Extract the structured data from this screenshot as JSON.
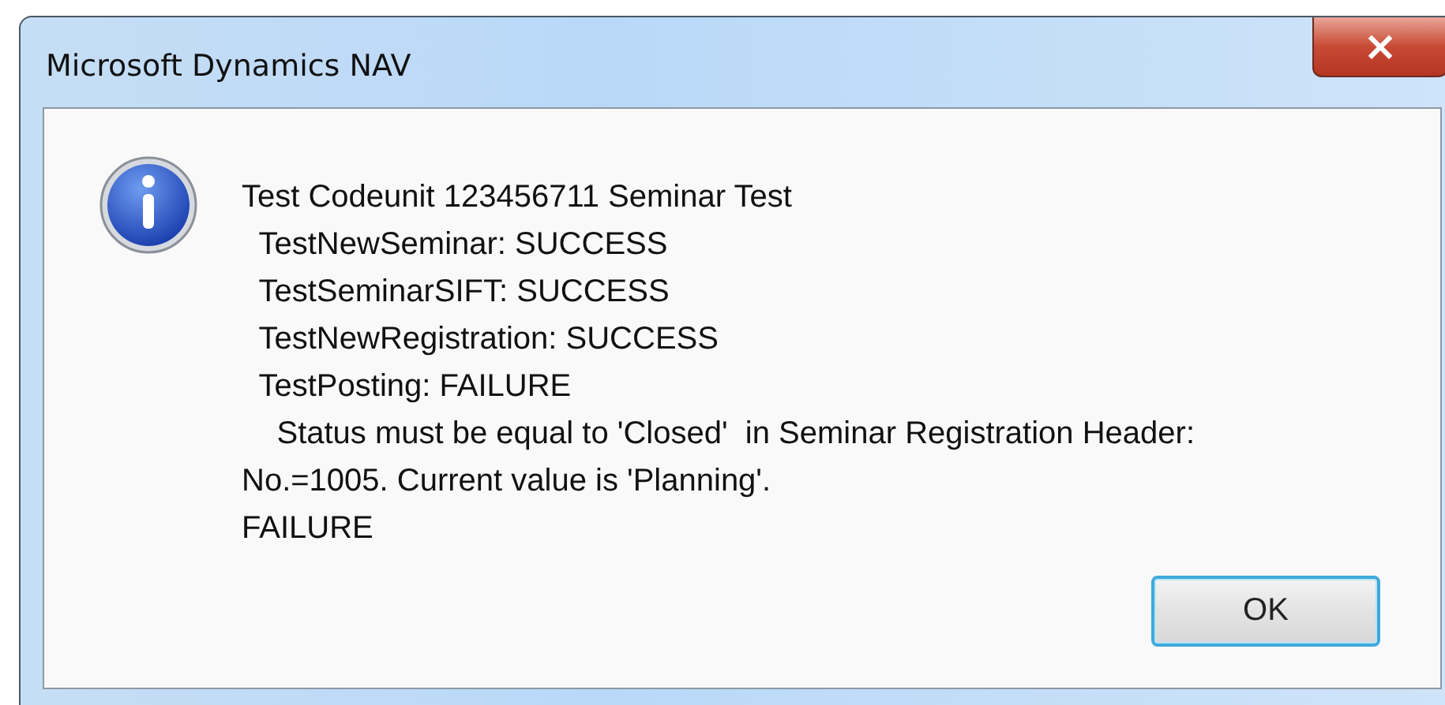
{
  "window": {
    "title": "Microsoft Dynamics NAV",
    "close": "×"
  },
  "message": {
    "lines": [
      "Test Codeunit 123456711 Seminar Test",
      "  TestNewSeminar: SUCCESS",
      "  TestSeminarSIFT: SUCCESS",
      "  TestNewRegistration: SUCCESS",
      "  TestPosting: FAILURE",
      "    Status must be equal to 'Closed'  in Seminar Registration Header:",
      "No.=1005. Current value is 'Planning'.",
      "FAILURE"
    ]
  },
  "buttons": [
    {
      "label": "OK",
      "focused": true
    }
  ]
}
